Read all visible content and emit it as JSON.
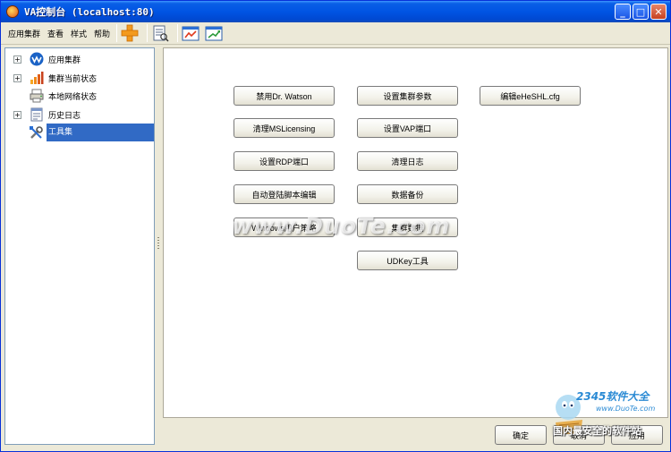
{
  "window": {
    "title": "VA控制台 (localhost:80)",
    "min_label": "_",
    "max_label": "□",
    "close_label": "✕"
  },
  "menu": {
    "items": [
      "应用集群",
      "查看",
      "样式",
      "帮助"
    ]
  },
  "toolbar": {
    "icons": [
      "add-icon",
      "document-icon",
      "chart-icon",
      "refresh-icon"
    ]
  },
  "tree": {
    "nodes": [
      {
        "label": "应用集群",
        "expander": "+",
        "icon": "va-logo-icon"
      },
      {
        "label": "集群当前状态",
        "expander": "+",
        "icon": "bar-chart-icon"
      },
      {
        "label": "本地网络状态",
        "expander": "",
        "icon": "network-printer-icon"
      },
      {
        "label": "历史日志",
        "expander": "+",
        "icon": "log-icon"
      },
      {
        "label": "工具集",
        "expander": "",
        "icon": "tools-icon",
        "selected": true
      }
    ]
  },
  "tools": {
    "col1": [
      "禁用Dr. Watson",
      "清理MSLicensing",
      "设置RDP端口",
      "自动登陆脚本编辑",
      "Windows用户策略"
    ],
    "col2": [
      "设置集群参数",
      "设置VAP端口",
      "清理日志",
      "数据备份",
      "集群数据",
      "UDKey工具"
    ],
    "col3": [
      "编辑eHeSHL.cfg"
    ]
  },
  "footer": {
    "ok_label": "确定",
    "cancel_label": "取消",
    "apply_label": "应用"
  },
  "watermarks": {
    "center": "www.DuoTe.com",
    "brand": "2345软件大全",
    "url": "www.DuoTe.com",
    "slogan": "国内最安全的软件站"
  },
  "colors": {
    "titlebar": "#0054e3",
    "selection": "#316ac5",
    "panel_bg": "#ffffff",
    "window_bg": "#ece9d8"
  }
}
